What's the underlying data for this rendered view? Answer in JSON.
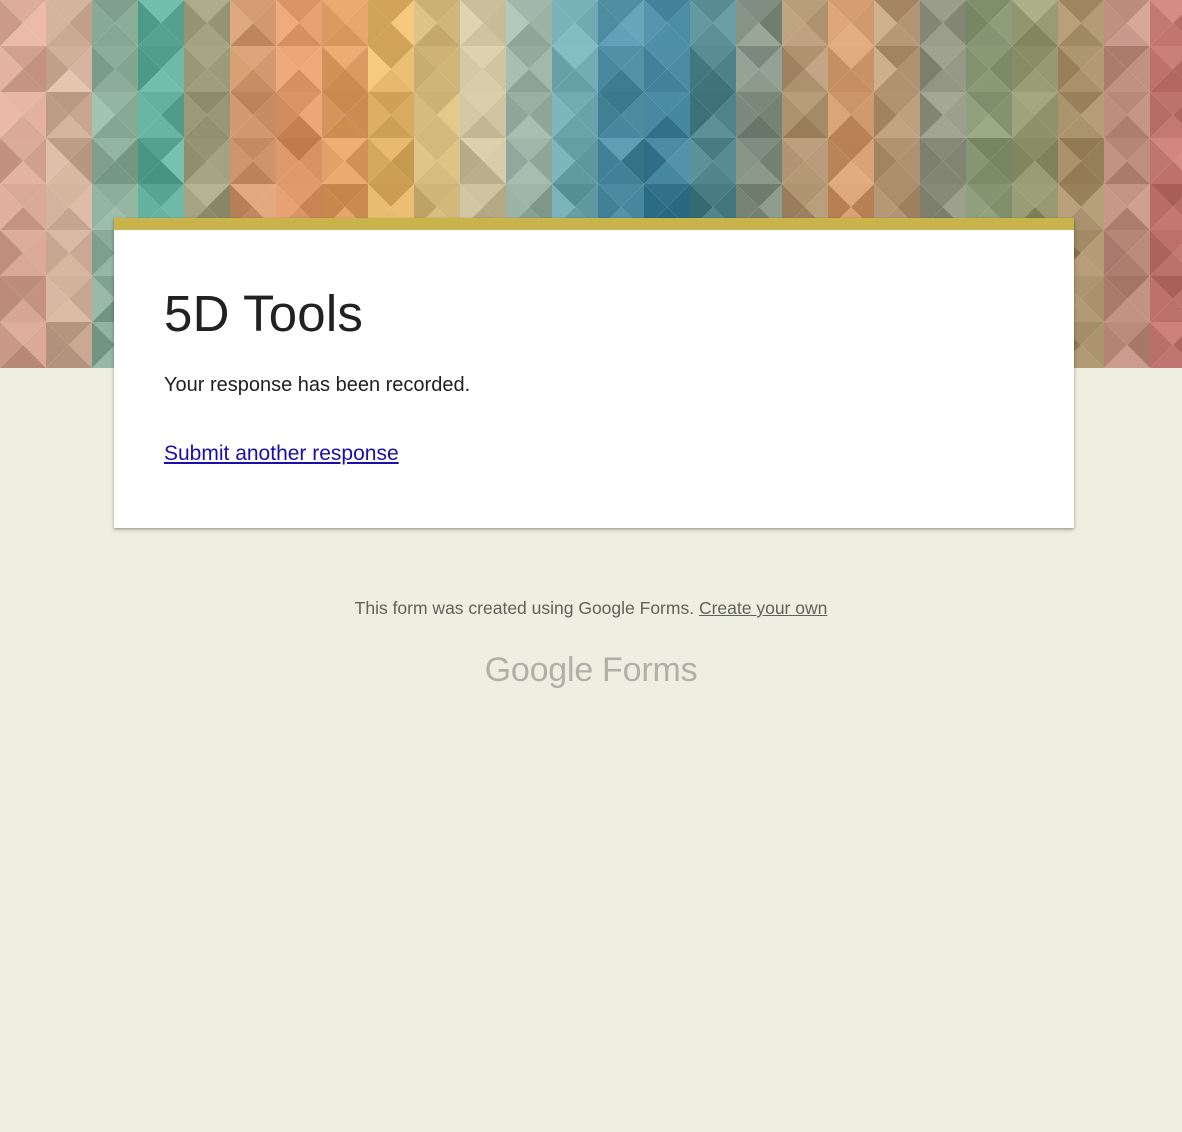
{
  "form": {
    "title": "5D Tools",
    "confirmation_message": "Your response has been recorded.",
    "submit_another_label": "Submit another response"
  },
  "footer": {
    "note_text": "This form was created using Google Forms.",
    "create_link_label": "Create your own",
    "brand_google": "Google",
    "brand_forms": "Forms"
  },
  "colors": {
    "page_background": "#eeefe1",
    "card_accent": "#c9b34b",
    "link": "#1a0dab"
  }
}
